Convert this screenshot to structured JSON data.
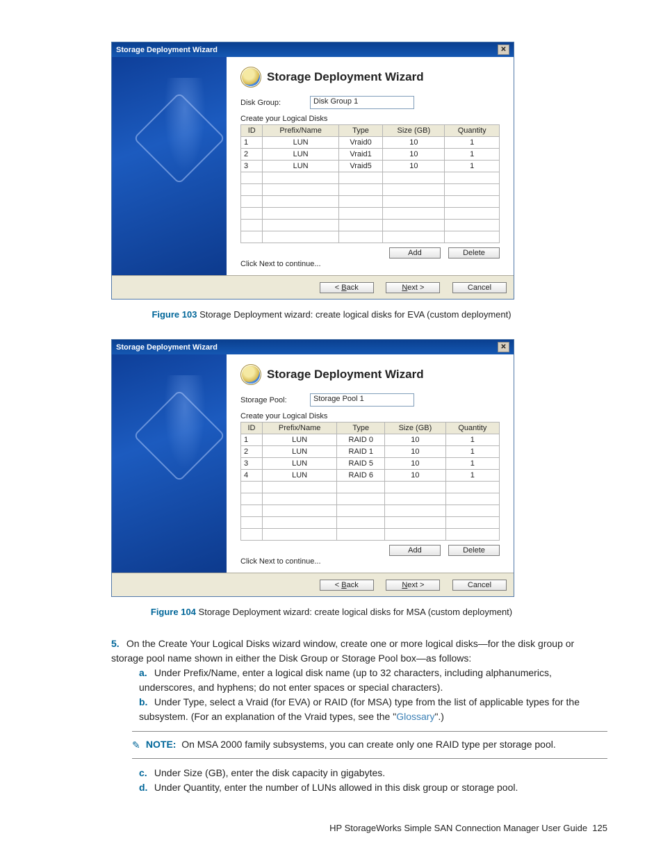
{
  "wizard1": {
    "title": "Storage Deployment Wizard",
    "heading": "Storage Deployment Wizard",
    "group_label": "Disk Group:",
    "group_value": "Disk Group 1",
    "create_label": "Create your Logical Disks",
    "headers": {
      "id": "ID",
      "prefix": "Prefix/Name",
      "type": "Type",
      "size": "Size (GB)",
      "qty": "Quantity"
    },
    "rows": [
      {
        "id": "1",
        "prefix": "LUN",
        "type": "Vraid0",
        "size": "10",
        "qty": "1",
        "dotted": false
      },
      {
        "id": "2",
        "prefix": "LUN",
        "type": "Vraid1",
        "size": "10",
        "qty": "1",
        "dotted": true
      },
      {
        "id": "3",
        "prefix": "LUN",
        "type": "Vraid5",
        "size": "10",
        "qty": "1",
        "dotted": false
      }
    ],
    "add": "Add",
    "delete": "Delete",
    "hint": "Click Next to continue...",
    "back": "< Back",
    "next": "Next >",
    "cancel": "Cancel",
    "caption_num": "Figure 103",
    "caption_text": "Storage Deployment wizard: create logical disks for EVA (custom deployment)"
  },
  "wizard2": {
    "title": "Storage Deployment Wizard",
    "heading": "Storage Deployment Wizard",
    "group_label": "Storage Pool:",
    "group_value": "Storage Pool 1",
    "create_label": "Create your Logical Disks",
    "headers": {
      "id": "ID",
      "prefix": "Prefix/Name",
      "type": "Type",
      "size": "Size (GB)",
      "qty": "Quantity"
    },
    "rows": [
      {
        "id": "1",
        "prefix": "LUN",
        "type": "RAID 0",
        "size": "10",
        "qty": "1",
        "dotted": false
      },
      {
        "id": "2",
        "prefix": "LUN",
        "type": "RAID 1",
        "size": "10",
        "qty": "1",
        "dotted": false
      },
      {
        "id": "3",
        "prefix": "LUN",
        "type": "RAID 5",
        "size": "10",
        "qty": "1",
        "dotted": true
      },
      {
        "id": "4",
        "prefix": "LUN",
        "type": "RAID 6",
        "size": "10",
        "qty": "1",
        "dotted": false
      }
    ],
    "add": "Add",
    "delete": "Delete",
    "hint": "Click Next to continue...",
    "back": "< Back",
    "next": "Next >",
    "cancel": "Cancel",
    "caption_num": "Figure 104",
    "caption_text": "Storage Deployment wizard: create logical disks for MSA (custom deployment)"
  },
  "step5": {
    "num": "5.",
    "text_a": "On the Create Your Logical Disks wizard window, create one or more logical disks—for the disk group or storage pool name shown in either the Disk Group or Storage Pool box—as follows:",
    "a_num": "a.",
    "a_text": "Under Prefix/Name, enter a logical disk name (up to 32 characters, including alphanumerics, underscores, and hyphens; do not enter spaces or special characters).",
    "b_num": "b.",
    "b_text_pre": "Under Type, select a Vraid (for EVA) or RAID (for MSA) type from the list of applicable types for the subsystem. (For an explanation of the Vraid types, see the \"",
    "b_link": "Glossary",
    "b_text_post": "\".)",
    "note_label": "NOTE:",
    "note_text": "On MSA 2000 family subsystems, you can create only one RAID type per storage pool.",
    "c_num": "c.",
    "c_text": "Under Size (GB), enter the disk capacity in gigabytes.",
    "d_num": "d.",
    "d_text": "Under Quantity, enter the number of LUNs allowed in this disk group or storage pool."
  },
  "footer": {
    "text": "HP StorageWorks Simple SAN Connection Manager User Guide",
    "page": "125"
  }
}
